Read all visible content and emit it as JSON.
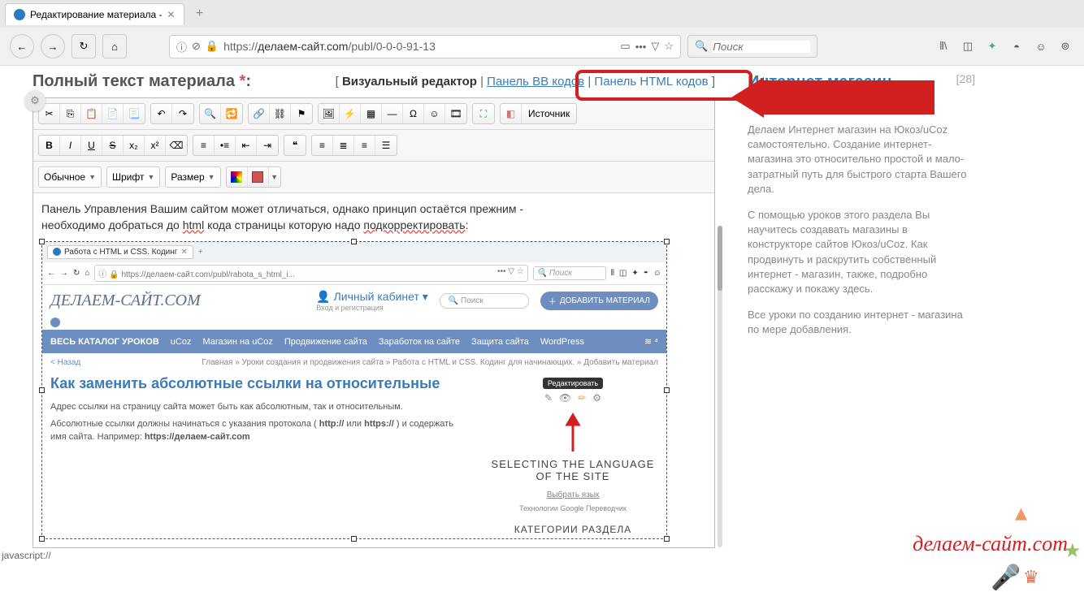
{
  "browser": {
    "tab_title": "Редактирование материала -",
    "url_prefix": "https://",
    "url_domain": "делаем-сайт.com",
    "url_path": "/publ/0-0-0-91-13",
    "search_placeholder": "Поиск"
  },
  "page": {
    "header": "Полный текст материала ",
    "star": "*",
    "colon": ":",
    "mode_visual": "Визуальный редактор",
    "mode_bb": "Панель BB кодов",
    "mode_html": "Панель HTML кодов"
  },
  "editor": {
    "source_btn": "Источник",
    "format_sel": "Обычное",
    "font_sel": "Шрифт",
    "size_sel": "Размер",
    "content_p1_a": "  Панель Управления Вашим сайтом может отличаться, однако принцип остаётся прежним -",
    "content_p1_b": "необходимо добраться до ",
    "content_p1_html": "html",
    "content_p1_c": " кода страницы которую надо ",
    "content_p1_corr": "подкорректировать",
    "content_p1_d": ":"
  },
  "inner": {
    "tab": "Работа с HTML и CSS. Кодинг",
    "url": "https://делаем-сайт.com/publ/rabota_s_html_i...",
    "search": "Поиск",
    "logo": "ДЕЛАЕМ-САЙТ.COM",
    "cabinet": "Личный кабинет",
    "cabinet_sub": "Вход и регистрация",
    "search2": "Поиск",
    "add_btn": "ДОБАВИТЬ МАТЕРИАЛ",
    "nav1": "ВЕСЬ КАТАЛОГ УРОКОВ",
    "nav2": "uCoz",
    "nav3": "Магазин на uCoz",
    "nav4": "Продвижение сайта",
    "nav5": "Заработок на сайте",
    "nav6": "Защита сайта",
    "nav7": "WordPress",
    "back": "< Назад",
    "breadcrumb": "Главная » Уроки создания и продвижения сайта » Работа с HTML и CSS. Кодинг для начинающих. » Добавить материал",
    "title": "Как заменить абсолютные ссылки на относительные",
    "edit_tip": "Редактировать",
    "lang_title1": "SELECTING THE LANGUAGE",
    "lang_title2": "OF THE SITE",
    "lang_sel": "Выбрать язык",
    "goog": "Технологии Google Переводчик",
    "cat": "КАТЕГОРИИ РАЗДЕЛА",
    "para1": "  Адрес ссылки на страницу сайта может быть как абсолютным, так и относительным.",
    "para2a": "  Абсолютные ссылки должны начинаться с указания протокола ( ",
    "para2b": "http://",
    "para2c": " или ",
    "para2d": "https://",
    "para2e": " ) и содержать имя сайта. Например: ",
    "para2f": "https://делаем-сайт.com"
  },
  "sidebar": {
    "title": "Интернет магазин Юкоз/uCoz",
    "count": "[28]",
    "p1": "Делаем Интернет магазин на Юкоз/uCoz самостоятельно. Создание интернет-магазина это относительно простой и мало-затратный путь для быстрого старта Вашего дела.",
    "p2": "С помощью уроков этого раздела Вы научитесь создавать магазины в конструкторе сайтов Юкоз/uCoz. Как продвинуть и раскрутить собственный интернет - магазин, также, подробно расскажу и покажу здесь.",
    "p3": "Все уроки по созданию интернет - магазина по мере добавления."
  },
  "foot_brand": "делаем-сайт.com",
  "foot_status": "javascript://"
}
